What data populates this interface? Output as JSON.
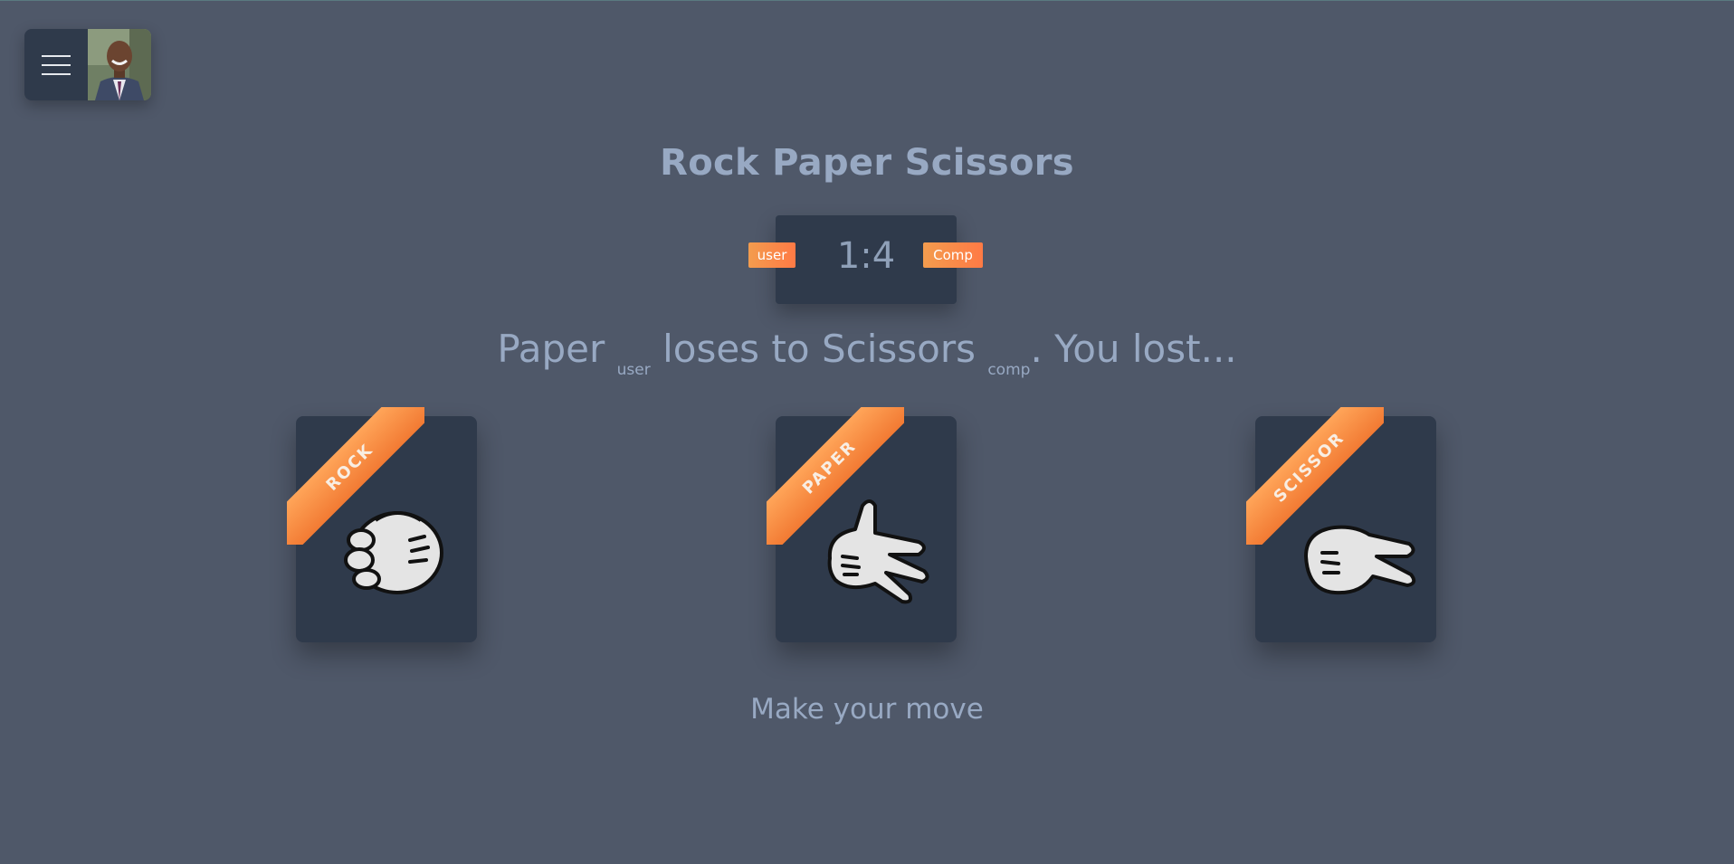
{
  "colors": {
    "background": "#4f5869",
    "panel": "#2f3a4b",
    "accent": "#f58a3f",
    "text": "#98a9c3"
  },
  "header": {
    "menu_icon": "hamburger-icon",
    "avatar": "user-avatar-photo"
  },
  "title": "Rock Paper Scissors",
  "scoreboard": {
    "user_label": "user",
    "score": "1:4",
    "comp_label": "Comp"
  },
  "result": {
    "user_choice": "Paper",
    "user_tag": "user",
    "verb": "loses to",
    "comp_choice": "Scissors",
    "comp_tag": "comp",
    "outcome": ". You lost..."
  },
  "choices": [
    {
      "label": "ROCK",
      "icon": "fist-glove-icon"
    },
    {
      "label": "PAPER",
      "icon": "open-hand-glove-icon"
    },
    {
      "label": "SCISSOR",
      "icon": "two-finger-glove-icon"
    }
  ],
  "prompt": "Make your move"
}
